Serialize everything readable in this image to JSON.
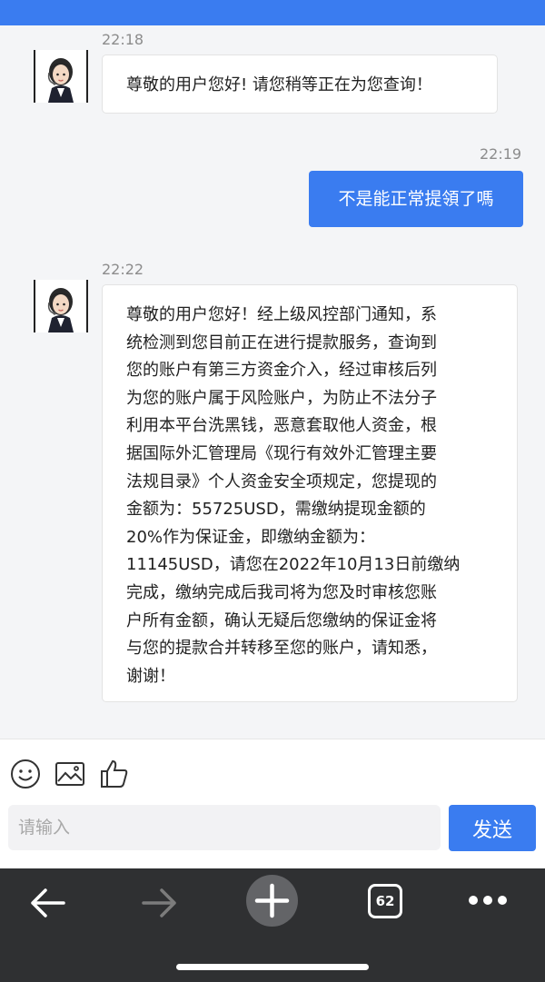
{
  "messages": [
    {
      "side": "left",
      "time": "22:18",
      "text": "尊敬的用户您好! 请您稍等正在为您查询！"
    },
    {
      "side": "right",
      "time": "22:19",
      "text": "不是能正常提領了嗎"
    },
    {
      "side": "left",
      "time": "22:22",
      "lines": [
        "尊敬的用户您好！经上级风控部门通知，系",
        "统检测到您目前正在进行提款服务，查询到",
        "您的账户有第三方资金介入，经过审核后列",
        "为您的账户属于风险账户，为防止不法分子",
        "利用本平台洗黑钱，恶意套取他人资金，根",
        "据国际外汇管理局《现行有效外汇管理主要",
        "法规目录》个人资金安全项规定，您提现的",
        "金额为：55725USD，需缴纳提现金额的",
        "20%作为保证金，即缴纳金额为：",
        "11145USD，请您在2022年10月13日前缴纳",
        "完成，缴纳完成后我司将为您及时审核您账",
        "户所有金额，确认无疑后您缴纳的保证金将",
        "与您的提款合并转移至您的账户，请知悉，",
        "谢谢！"
      ]
    }
  ],
  "composer": {
    "placeholder": "请输入",
    "send_label": "发送",
    "tools": [
      "emoji-icon",
      "image-icon",
      "thumbs-up-icon"
    ]
  },
  "browser_nav": {
    "tab_count": "62",
    "icons": [
      "back-arrow-icon",
      "forward-arrow-icon",
      "new-tab-plus-icon",
      "tabs-icon",
      "more-icon"
    ]
  },
  "colors": {
    "accent": "#3a7cf0",
    "nav_bg": "#2f3032",
    "chat_bg": "#f4f5f7"
  }
}
